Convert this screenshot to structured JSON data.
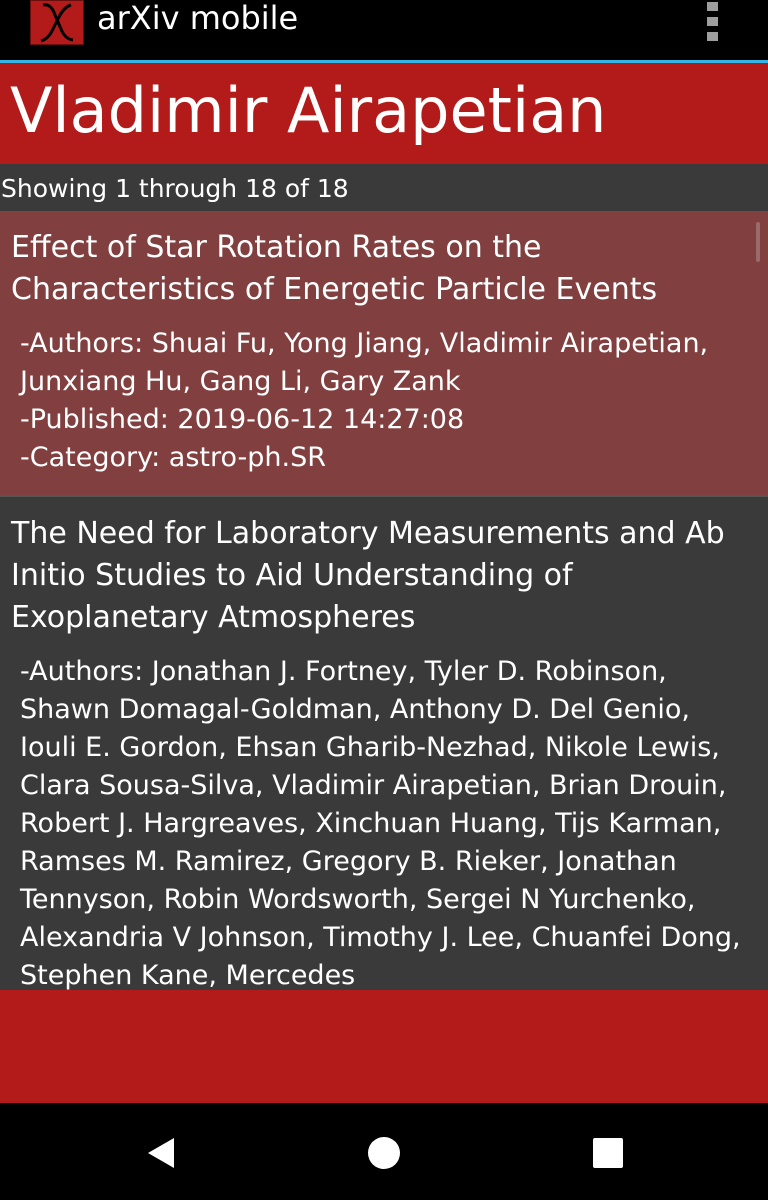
{
  "app": {
    "title": "arXiv mobile",
    "icon": "arxiv-x-logo-icon",
    "menu_icon": "overflow-menu-icon",
    "colors": {
      "brand_red": "#b31b1b",
      "selected_item": "#813f3f",
      "list_background": "#3a3a3a",
      "accent_line": "#33b5e5"
    }
  },
  "header": {
    "author_name": "Vladimir Airapetian"
  },
  "results": {
    "count_text": "Showing 1 through 18 of 18"
  },
  "papers": [
    {
      "title": "Effect of Star Rotation Rates on the Characteristics of Energetic Particle Events",
      "authors": "-Authors: Shuai Fu, Yong Jiang, Vladimir Airapetian, Junxiang Hu, Gang Li, Gary Zank",
      "published": "-Published: 2019-06-12 14:27:08",
      "category": "-Category: astro-ph.SR"
    },
    {
      "title": "The Need for Laboratory Measurements and Ab Initio Studies to Aid Understanding of Exoplanetary Atmospheres",
      "authors": "-Authors: Jonathan J. Fortney, Tyler D. Robinson, Shawn Domagal-Goldman, Anthony D. Del Genio, Iouli E. Gordon, Ehsan Gharib-Nezhad, Nikole Lewis, Clara Sousa-Silva, Vladimir Airapetian, Brian Drouin, Robert J. Hargreaves, Xinchuan Huang, Tijs Karman, Ramses M. Ramirez, Gregory B. Rieker, Jonathan Tennyson, Robin Wordsworth, Sergei N Yurchenko, Alexandria V Johnson, Timothy J. Lee, Chuanfei Dong, Stephen Kane, Mercedes"
    }
  ],
  "navigation": {
    "back_icon": "back-triangle-icon",
    "home_icon": "home-circle-icon",
    "recent_icon": "recent-apps-square-icon"
  }
}
